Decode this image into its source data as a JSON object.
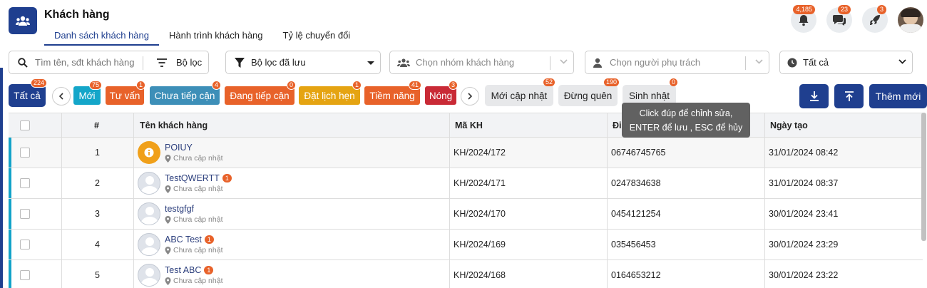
{
  "header": {
    "title": "Khách hàng",
    "tabs": [
      "Danh sách khách hàng",
      "Hành trình khách hàng",
      "Tỷ lệ chuyển đổi"
    ],
    "notifications": {
      "bell": "4,185",
      "chat": "23",
      "rocket": "3"
    }
  },
  "filters": {
    "search_placeholder": "Tìm tên, sđt khách hàng",
    "filter_label": "Bộ lọc",
    "saved_filter": "Bộ lọc đã lưu",
    "group_placeholder": "Chọn nhóm khách hàng",
    "owner_placeholder": "Chọn người phụ trách",
    "status": "Tất cả"
  },
  "chips": {
    "all": {
      "label": "Tất cả",
      "count": "224"
    },
    "items": [
      {
        "label": "Mới",
        "count": "75",
        "color": "#14a6c9"
      },
      {
        "label": "Tư vấn",
        "count": "1",
        "color": "#e8622a"
      },
      {
        "label": "Chưa tiếp cận",
        "count": "4",
        "color": "#3d8fb8"
      },
      {
        "label": "Đang tiếp cận",
        "count": "0",
        "color": "#e8622a"
      },
      {
        "label": "Đặt lịch hẹn",
        "count": "1",
        "color": "#e5a412"
      },
      {
        "label": "Tiềm năng",
        "count": "41",
        "color": "#e8622a"
      },
      {
        "label": "Nóng",
        "count": "3",
        "color": "#c92a36"
      }
    ],
    "gray": [
      {
        "label": "Mới cập nhật",
        "count": "52"
      },
      {
        "label": "Đừng quên",
        "count": "190"
      },
      {
        "label": "Sinh nhật",
        "count": "0"
      }
    ]
  },
  "actions": {
    "add_label": "Thêm mới"
  },
  "tooltip": {
    "line1": "Click đúp để chỉnh sửa,",
    "line2": "ENTER để lưu , ESC để hủy"
  },
  "table": {
    "columns": {
      "index": "#",
      "name": "Tên khách hàng",
      "code": "Mã KH",
      "phone": "Đi",
      "created": "Ngày tạo"
    },
    "rows": [
      {
        "index": "1",
        "name": "POIUY",
        "badge": "",
        "location": "Chưa cập nhật",
        "code": "KH/2024/172",
        "phone": "06746745765",
        "created": "31/01/2024 08:42"
      },
      {
        "index": "2",
        "name": "TestQWERTT",
        "badge": "1",
        "location": "Chưa cập nhật",
        "code": "KH/2024/171",
        "phone": "0247834638",
        "created": "31/01/2024 08:37"
      },
      {
        "index": "3",
        "name": "testgfgf",
        "badge": "",
        "location": "Chưa cập nhật",
        "code": "KH/2024/170",
        "phone": "0454121254",
        "created": "30/01/2024 23:41"
      },
      {
        "index": "4",
        "name": "ABC Test",
        "badge": "1",
        "location": "Chưa cập nhật",
        "code": "KH/2024/169",
        "phone": "035456453",
        "created": "30/01/2024 23:29"
      },
      {
        "index": "5",
        "name": "Test ABC",
        "badge": "1",
        "location": "Chưa cập nhật",
        "code": "KH/2024/168",
        "phone": "0164653212",
        "created": "30/01/2024 23:22"
      }
    ]
  }
}
